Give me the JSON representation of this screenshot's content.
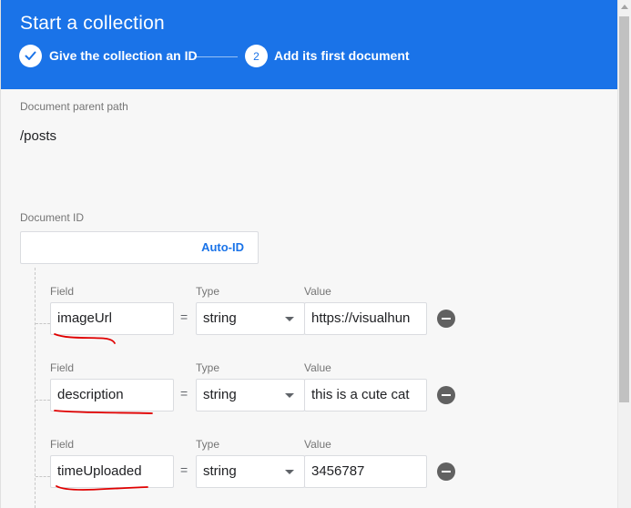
{
  "dialog": {
    "title": "Start a collection",
    "steps": [
      {
        "label": "Give the collection an ID",
        "state": "complete",
        "icon": "check-icon"
      },
      {
        "label": "Add its first document",
        "state": "active",
        "number": "2"
      }
    ]
  },
  "parent_path": {
    "label": "Document parent path",
    "value": "/posts"
  },
  "document_id": {
    "label": "Document ID",
    "value": "",
    "auto_id_label": "Auto-ID"
  },
  "column_labels": {
    "field": "Field",
    "type": "Type",
    "value": "Value"
  },
  "equals_sign": "=",
  "fields": [
    {
      "field": "imageUrl",
      "type": "string",
      "value": "https://visualhun"
    },
    {
      "field": "description",
      "type": "string",
      "value": "this is a cute cat"
    },
    {
      "field": "timeUploaded",
      "type": "string",
      "value": "3456787"
    }
  ],
  "colors": {
    "header": "#1a73e8",
    "annotation": "#e00000",
    "remove_button": "#616161"
  }
}
